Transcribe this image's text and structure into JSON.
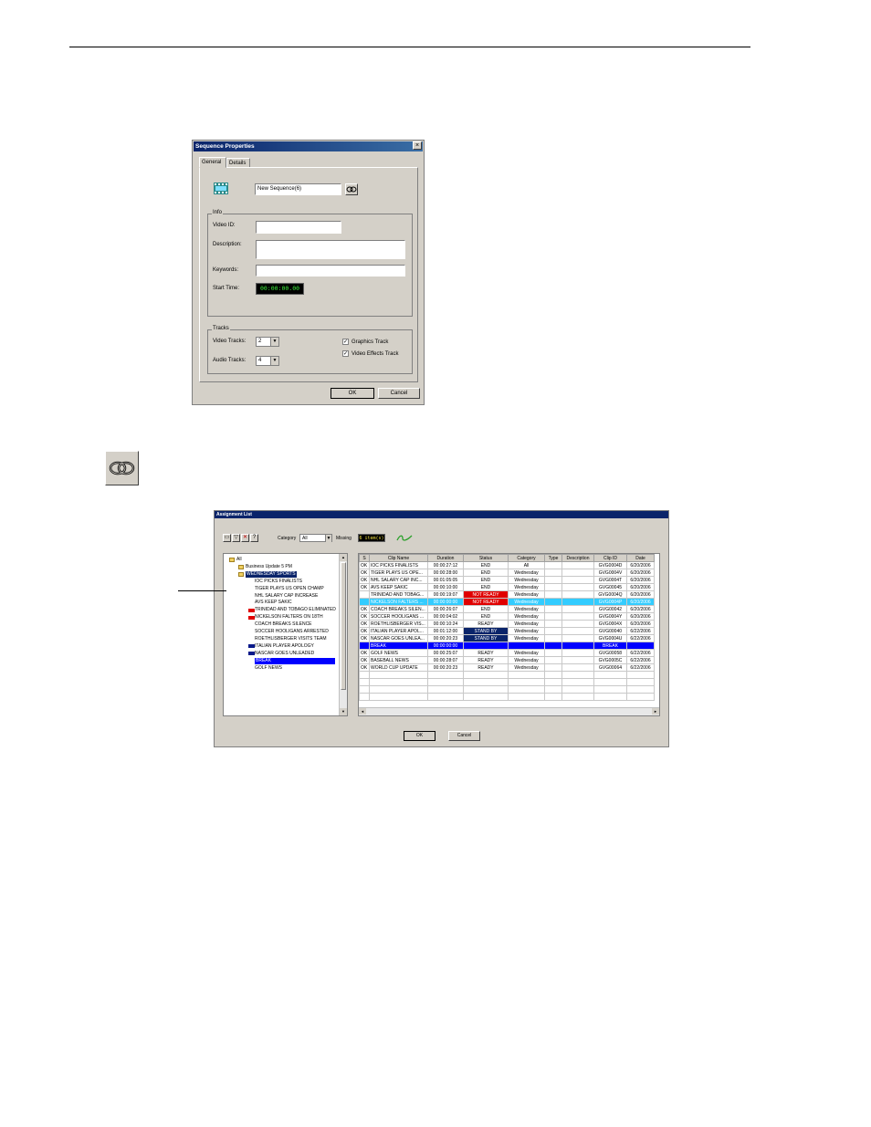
{
  "seq_dialog": {
    "title": "Sequence Properties",
    "close_glyph": "×",
    "tabs": [
      "General",
      "Details"
    ],
    "name_value": "New Sequence(6)",
    "info_group": "Info",
    "video_id_label": "Video ID:",
    "video_id_value": "",
    "description_label": "Description:",
    "description_value": "",
    "keywords_label": "Keywords:",
    "keywords_value": "",
    "start_time_label": "Start Time:",
    "start_time_value": "00:00:00.00",
    "tracks_group": "Tracks",
    "video_tracks_label": "Video Tracks:",
    "video_tracks_value": "2",
    "audio_tracks_label": "Audio Tracks:",
    "audio_tracks_value": "4",
    "graphics_track_label": "Graphics Track",
    "graphics_track_checked": true,
    "video_effects_label": "Video Effects Track",
    "video_effects_checked": true,
    "check_glyph": "✓",
    "dropdown_glyph": "▼",
    "ok_label": "OK",
    "cancel_label": "Cancel"
  },
  "assignment": {
    "title": "Assignment List",
    "category_label": "Category",
    "category_value": "All",
    "missing_label": "Missing",
    "missing_value": "6 item(s)",
    "toolbar_glyphs": [
      "▭",
      "▽",
      "✕",
      "?"
    ],
    "tree": [
      {
        "label": "All",
        "indent": 0,
        "marker": "folder"
      },
      {
        "label": "Business Update 5 PM",
        "indent": 1,
        "marker": "folder"
      },
      {
        "label": "WEDNESDAY SPORTS",
        "indent": 1,
        "marker": "folder",
        "selected": "dark"
      },
      {
        "label": "IOC PICKS FINALISTS",
        "indent": 2,
        "marker": "none"
      },
      {
        "label": "TIGER PLAYS US OPEN CHAMP",
        "indent": 2,
        "marker": "none"
      },
      {
        "label": "NHL SALARY CAP INCREASE",
        "indent": 2,
        "marker": "none"
      },
      {
        "label": "AVS KEEP SAKIC",
        "indent": 2,
        "marker": "none"
      },
      {
        "label": "TRINIDAD AND TOBAGO ELIMINATED",
        "indent": 2,
        "marker": "red"
      },
      {
        "label": "NICKELSON FALTERS ON 18TH",
        "indent": 2,
        "marker": "red"
      },
      {
        "label": "COACH BREAKS SILENCE",
        "indent": 2,
        "marker": "none"
      },
      {
        "label": "SOCCER HOOLIGANS ARRESTED",
        "indent": 2,
        "marker": "none"
      },
      {
        "label": "ROETHLISBERGER VISITS TEAM",
        "indent": 2,
        "marker": "none"
      },
      {
        "label": "ITALIAN PLAYER APOLOGY",
        "indent": 2,
        "marker": "navy"
      },
      {
        "label": "NASCAR GOES UNLEADED",
        "indent": 2,
        "marker": "navy"
      },
      {
        "label": "BREAK",
        "indent": 2,
        "marker": "none",
        "selected": "blue"
      },
      {
        "label": "GOLF NEWS",
        "indent": 2,
        "marker": "none"
      }
    ],
    "columns": [
      "S",
      "Clip Name",
      "Duration",
      "Status",
      "Category",
      "Type",
      "Description",
      "Clip ID",
      "Date"
    ],
    "rows": [
      {
        "s": "OK",
        "name": "IOC PICKS FINALISTS",
        "dur": "00:00:27:12",
        "status": "END",
        "cat": "All",
        "type": "",
        "desc": "",
        "clip": "GVG0004D",
        "date": "6/20/2006",
        "style": ""
      },
      {
        "s": "OK",
        "name": "TIGER PLAYS US OPE...",
        "dur": "00:00:28:00",
        "status": "END",
        "cat": "Wednesday",
        "type": "",
        "desc": "",
        "clip": "GVG0004V",
        "date": "6/20/2006",
        "style": ""
      },
      {
        "s": "OK",
        "name": "NHL SALARY CAP INC...",
        "dur": "00:01:05:05",
        "status": "END",
        "cat": "Wednesday",
        "type": "",
        "desc": "",
        "clip": "GVG0004T",
        "date": "6/20/2006",
        "style": ""
      },
      {
        "s": "OK",
        "name": "AVS KEEP SAKIC",
        "dur": "00:00:10:00",
        "status": "END",
        "cat": "Wednesday",
        "type": "",
        "desc": "",
        "clip": "GVG00045",
        "date": "6/20/2006",
        "style": ""
      },
      {
        "s": "",
        "name": "TRINIDAD AND TOBAG...",
        "dur": "00:00:19:07",
        "status": "NOT READY",
        "cat": "Wednesday",
        "type": "",
        "desc": "",
        "clip": "GVG0004Q",
        "date": "6/20/2006",
        "style": "nr"
      },
      {
        "s": "",
        "name": "NICKELSON FALTERS ...",
        "dur": "00:00:00:00",
        "status": "NOT READY",
        "cat": "Wednesday",
        "type": "",
        "desc": "",
        "clip": "GVG0004P",
        "date": "6/20/2006",
        "style": "cyan-nr"
      },
      {
        "s": "OK",
        "name": "COACH BREAKS SILEN...",
        "dur": "00:00:26:07",
        "status": "END",
        "cat": "Wednesday",
        "type": "",
        "desc": "",
        "clip": "GVG00042",
        "date": "6/20/2006",
        "style": ""
      },
      {
        "s": "OK",
        "name": "SOCCER HOOLIGANS ...",
        "dur": "00:00:04:02",
        "status": "END",
        "cat": "Wednesday",
        "type": "",
        "desc": "",
        "clip": "GVG0004Y",
        "date": "6/20/2006",
        "style": ""
      },
      {
        "s": "OK",
        "name": "ROETHLISBERGER VIS...",
        "dur": "00:00:10:24",
        "status": "READY",
        "cat": "Wednesday",
        "type": "",
        "desc": "",
        "clip": "GVG0004X",
        "date": "6/20/2006",
        "style": ""
      },
      {
        "s": "OK",
        "name": "ITALIAN PLAYER APOL...",
        "dur": "00:01:12:00",
        "status": "STAND BY",
        "cat": "Wednesday",
        "type": "",
        "desc": "",
        "clip": "GVG00040",
        "date": "6/22/2006",
        "style": "sb"
      },
      {
        "s": "OK",
        "name": "NASCAR GOES UNLEA...",
        "dur": "00:00:20:23",
        "status": "STAND BY",
        "cat": "Wednesday",
        "type": "",
        "desc": "",
        "clip": "GVG0004U",
        "date": "6/22/2006",
        "style": "sb"
      },
      {
        "s": "",
        "name": "BREAK",
        "dur": "00:00:00:00",
        "status": "",
        "cat": "",
        "type": "",
        "desc": "",
        "clip": "BREAK",
        "date": "",
        "style": "blue"
      },
      {
        "s": "OK",
        "name": "GOLF NEWS",
        "dur": "00:00:25:07",
        "status": "READY",
        "cat": "Wednesday",
        "type": "",
        "desc": "",
        "clip": "GVG00058",
        "date": "6/22/2006",
        "style": ""
      },
      {
        "s": "OK",
        "name": "BASEBALL NEWS",
        "dur": "00:00:28:07",
        "status": "READY",
        "cat": "Wednesday",
        "type": "",
        "desc": "",
        "clip": "GVG0005C",
        "date": "6/22/2006",
        "style": ""
      },
      {
        "s": "OK",
        "name": "WORLD CUP UPDATE",
        "dur": "00:00:20:23",
        "status": "READY",
        "cat": "Wednesday",
        "type": "",
        "desc": "",
        "clip": "GVG00064",
        "date": "6/22/2006",
        "style": ""
      }
    ],
    "empty_rows": 4,
    "scroll_glyphs": {
      "up": "▲",
      "down": "▼",
      "left": "◄",
      "right": "►"
    },
    "ok_label": "OK",
    "cancel_label": "Cancel"
  }
}
